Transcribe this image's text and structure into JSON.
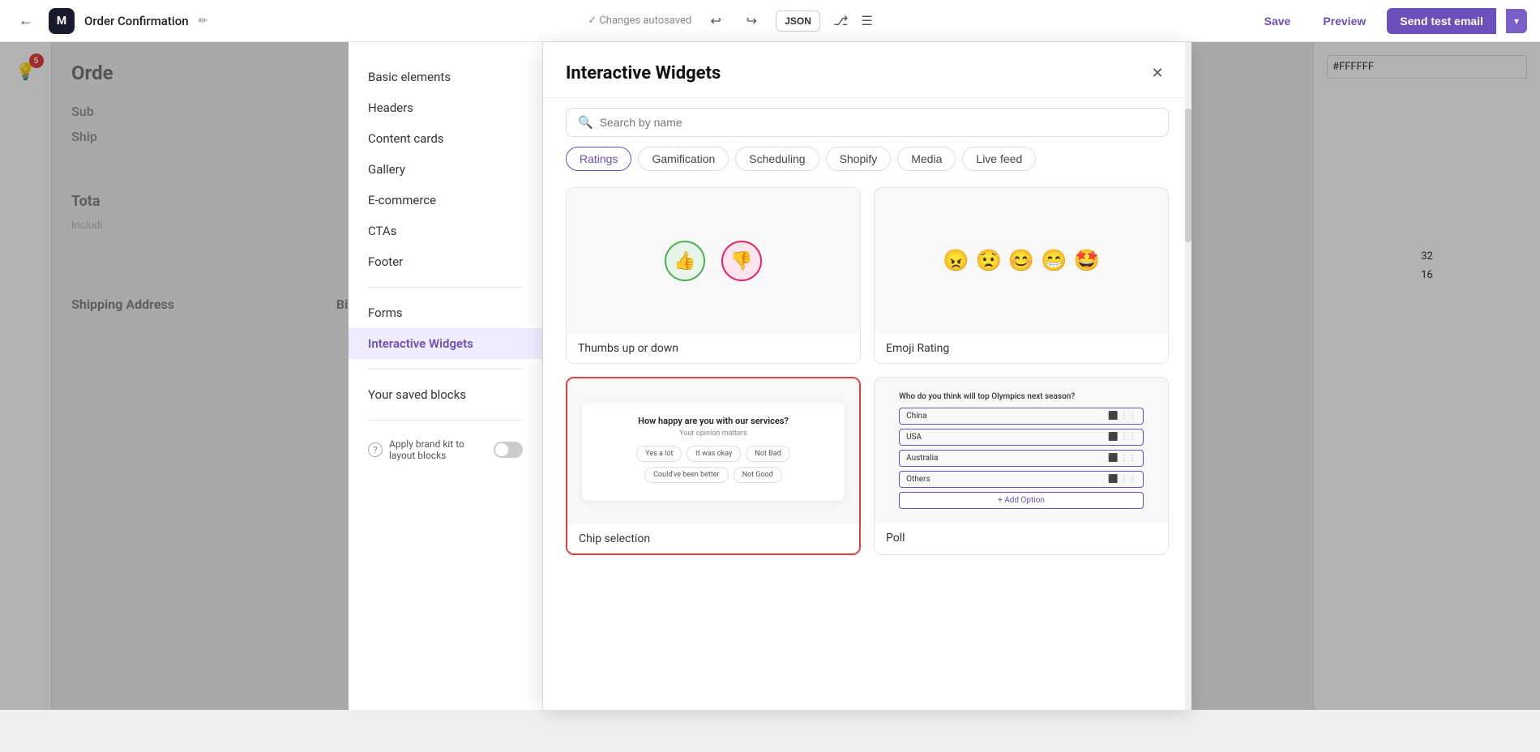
{
  "toolbar": {
    "back_label": "←",
    "logo_label": "M",
    "title": "Order Confirmation",
    "edit_icon": "✏",
    "autosaved": "✓ Changes autosaved",
    "undo_icon": "↩",
    "redo_icon": "↪",
    "json_label": "JSON",
    "share_icon": "⎇",
    "note_icon": "☰",
    "save_label": "Save",
    "preview_label": "Preview",
    "send_label": "Send test email",
    "send_dropdown": "▾"
  },
  "left_panel": {
    "badge_count": "5",
    "bulb": "💡"
  },
  "background": {
    "title": "Orde",
    "sub_label": "Sub",
    "ship_label": "Ship",
    "total_label": "Tota",
    "including_label": "Includi",
    "shipping_address": "Shipping Address",
    "billing_address": "Billing Address"
  },
  "right_sidebar": {
    "color_value": "#FFFFFF",
    "number1": "32",
    "number2": "16"
  },
  "modal_sidebar": {
    "items": [
      {
        "id": "basic-elements",
        "label": "Basic elements",
        "active": false
      },
      {
        "id": "headers",
        "label": "Headers",
        "active": false
      },
      {
        "id": "content-cards",
        "label": "Content cards",
        "active": false
      },
      {
        "id": "gallery",
        "label": "Gallery",
        "active": false
      },
      {
        "id": "e-commerce",
        "label": "E-commerce",
        "active": false
      },
      {
        "id": "ctas",
        "label": "CTAs",
        "active": false
      },
      {
        "id": "footer",
        "label": "Footer",
        "active": false
      }
    ],
    "items2": [
      {
        "id": "forms",
        "label": "Forms",
        "active": false
      },
      {
        "id": "interactive-widgets",
        "label": "Interactive Widgets",
        "active": true
      }
    ],
    "saved_blocks_label": "Your saved blocks",
    "brand_kit_label": "Apply brand kit to layout blocks",
    "help_icon": "?"
  },
  "modal": {
    "title": "Interactive Widgets",
    "close_icon": "✕",
    "search_placeholder": "Search by name",
    "tabs": [
      {
        "id": "ratings",
        "label": "Ratings",
        "active": true
      },
      {
        "id": "gamification",
        "label": "Gamification",
        "active": false
      },
      {
        "id": "scheduling",
        "label": "Scheduling",
        "active": false
      },
      {
        "id": "shopify",
        "label": "Shopify",
        "active": false
      },
      {
        "id": "media",
        "label": "Media",
        "active": false
      },
      {
        "id": "live-feed",
        "label": "Live feed",
        "active": false
      }
    ],
    "widgets": [
      {
        "id": "thumbs-up-down",
        "label": "Thumbs up or down",
        "type": "thumbs",
        "selected": false
      },
      {
        "id": "emoji-rating",
        "label": "Emoji Rating",
        "type": "emoji",
        "selected": false
      },
      {
        "id": "chip-selection",
        "label": "Chip selection",
        "type": "chip",
        "selected": true
      },
      {
        "id": "poll",
        "label": "Poll",
        "type": "poll",
        "selected": false
      }
    ],
    "chip": {
      "question": "How happy are you with our services?",
      "subtitle": "Your opinion matters",
      "options_row1": [
        "Yes a lot",
        "It was okay",
        "Not Bad"
      ],
      "options_row2": [
        "Could've been better",
        "Not Good"
      ]
    },
    "poll": {
      "question": "Who do you think will top Olympics next season?",
      "options": [
        "China",
        "USA",
        "Australia",
        "Others"
      ],
      "add_option_label": "+ Add Option"
    }
  }
}
